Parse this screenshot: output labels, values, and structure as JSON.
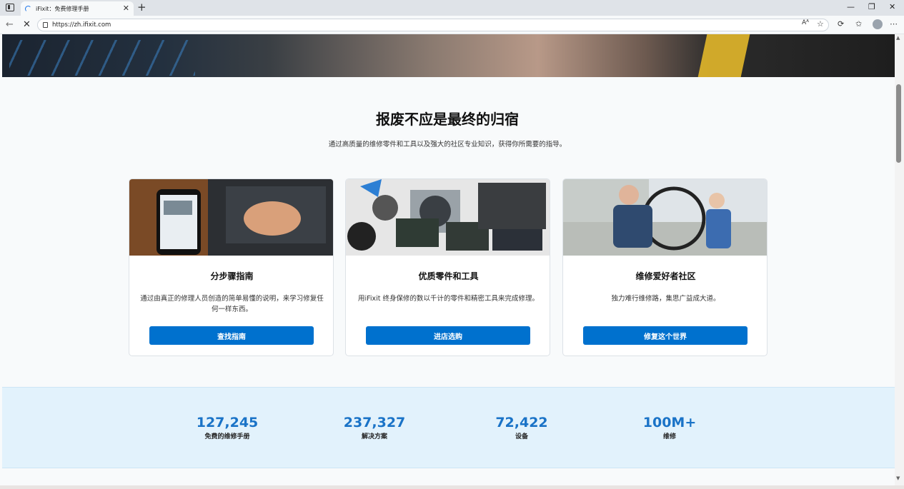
{
  "browser": {
    "tab_title": "iFixit：免费修理手册",
    "tab_close": "✕",
    "new_tab": "+",
    "url": "https://zh.ifixit.com",
    "window": {
      "minimize": "—",
      "restore": "❐",
      "close": "✕"
    }
  },
  "page": {
    "title": "报废不应是最终的归宿",
    "subtitle": "通过高质量的维修零件和工具以及强大的社区专业知识，获得你所需要的指导。",
    "cards": [
      {
        "title": "分步骤指南",
        "text": "通过由真正的修理人员创造的简单易懂的说明，来学习修复任何一样东西。",
        "button": "查找指南"
      },
      {
        "title": "优质零件和工具",
        "text": "用iFixit 终身保修的数以千计的零件和精密工具来完成修理。",
        "button": "进店选购"
      },
      {
        "title": "维修爱好者社区",
        "text": "独力难行维修路，集思广益成大道。",
        "button": "修复这个世界"
      }
    ],
    "stats": [
      {
        "value": "127,245",
        "label": "免费的维修手册"
      },
      {
        "value": "237,327",
        "label": "解决方案"
      },
      {
        "value": "72,422",
        "label": "设备"
      },
      {
        "value": "100M+",
        "label": "维修"
      }
    ]
  },
  "colors": {
    "accent": "#0071ce",
    "stats_bg": "#e2f2fc",
    "stat_number": "#1a73c7"
  }
}
